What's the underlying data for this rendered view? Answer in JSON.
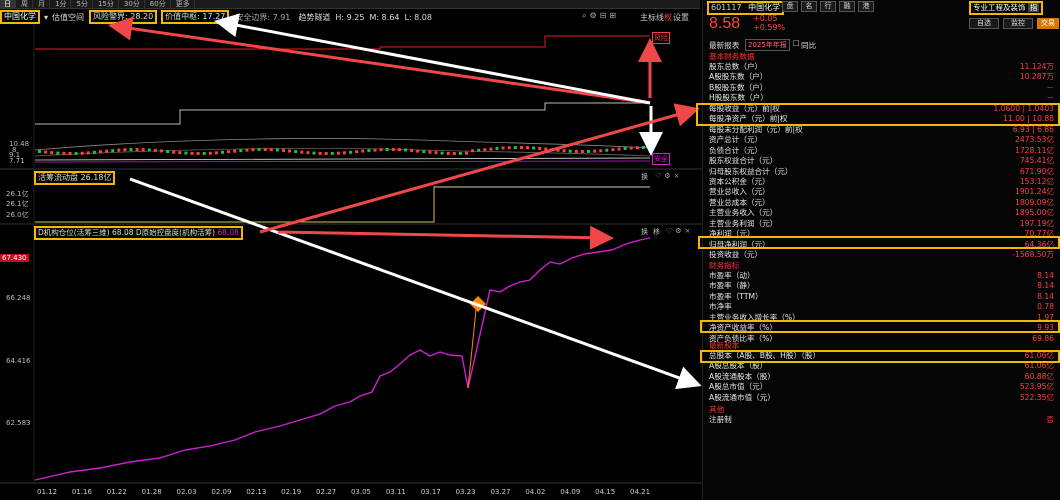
{
  "tabs": [
    "日",
    "周",
    "月",
    "1分",
    "5分",
    "15分",
    "30分",
    "60分",
    "更多"
  ],
  "title": {
    "stock_name": "中国化学",
    "label_space": "估值空间",
    "risk_label": "风险警界",
    "risk_value": "28.20",
    "center_label": "价值中枢",
    "center_value": "17.27",
    "safe_label": "安全边界",
    "safe_value": "7.91",
    "trend_label": "趋势隧道",
    "h_label": "H",
    "h_value": "9.25",
    "m_label": "M",
    "m_value": "8.64",
    "l_label": "L",
    "l_value": "8.08",
    "mode_label": "主标线",
    "ctrl_label": "权",
    "settings_label": "设置"
  },
  "main_chart": {
    "y_ticks": [
      "10.48",
      "8",
      "9.1",
      "7.71"
    ],
    "tag_risk": "风险",
    "tag_safe": "安全"
  },
  "sub1": {
    "label": "活筹流动盘",
    "value": "26.18亿",
    "y_ticks": [
      "26.1亿",
      "26.1亿",
      "26.0亿"
    ],
    "icon_text": "换"
  },
  "sub2": {
    "label": "D机构仓位(活筹三维)",
    "value1": "68.08",
    "label2": "D原始控盘度(机构活筹)",
    "value2": "68.08",
    "icon_text1": "换",
    "icon_text2": "移",
    "y_ticks": [
      "67.430",
      "66.248",
      "64.416",
      "62.583"
    ]
  },
  "x_axis": [
    "01.12",
    "01.16",
    "01.22",
    "01.28",
    "02.03",
    "02.09",
    "02.13",
    "02.19",
    "02.27",
    "03.05",
    "03.11",
    "03.17",
    "03.23",
    "03.27",
    "04.02",
    "04.09",
    "04.15",
    "04.21"
  ],
  "right": {
    "code": "601117",
    "name": "中国化学",
    "tabs": [
      "盘",
      "名",
      "行",
      "融",
      "港"
    ],
    "price": "8.58",
    "chg": "+0.05",
    "pct": "+0.59%",
    "industry": "专业工程及装饰",
    "industry_tag": "指",
    "btn_add": "自选",
    "btn_monitor": "监控",
    "btn_trade": "交易",
    "report_label": "最新报表",
    "report_year": "2025年年报",
    "compare_label": "同比",
    "sections": {
      "basic": "基本财务数据",
      "ratio": "财务指标",
      "capital": "最新股本",
      "other": "其他"
    },
    "basic_rows": [
      {
        "l": "股东总数（户）",
        "v": "11.124万"
      },
      {
        "l": "A股股东数（户）",
        "v": "10.287万"
      },
      {
        "l": "B股股东数（户）",
        "v": "－"
      },
      {
        "l": "H股股东数（户）",
        "v": "－"
      },
      {
        "l": "每股收益（元）前|权",
        "v": "1.0600 | 1.0403"
      },
      {
        "l": "每股净资产（元）前|权",
        "v": "11.00 | 10.88"
      },
      {
        "l": "每股未分配利润（元）前|权",
        "v": "6.93 | 6.86"
      },
      {
        "l": "资产总计（元）",
        "v": "2473.53亿"
      },
      {
        "l": "负债合计（元）",
        "v": "1728.11亿"
      },
      {
        "l": "股东权益合计（元）",
        "v": "745.41亿"
      },
      {
        "l": "归母股东权益合计（元）",
        "v": "671.90亿"
      },
      {
        "l": "资本公积金（元）",
        "v": "153.12亿"
      },
      {
        "l": "营业总收入（元）",
        "v": "1901.24亿"
      },
      {
        "l": "营业总成本（元）",
        "v": "1809.09亿"
      },
      {
        "l": "主营业务收入（元）",
        "v": "1895.00亿"
      },
      {
        "l": "主营业务利润（元）",
        "v": "197.19亿"
      },
      {
        "l": "净利润（元）",
        "v": "70.77亿"
      },
      {
        "l": "归母净利润（元）",
        "v": "64.36亿"
      },
      {
        "l": "投资收益（元）",
        "v": "-1568.50万"
      }
    ],
    "ratio_rows": [
      {
        "l": "市盈率（动）",
        "v": "8.14"
      },
      {
        "l": "市盈率（静）",
        "v": "8.14"
      },
      {
        "l": "市盈率（TTM）",
        "v": "8.14"
      },
      {
        "l": "市净率",
        "v": "0.78"
      },
      {
        "l": "主营业务收入增长率（%）",
        "v": "1.97"
      },
      {
        "l": "净资产收益率（%）",
        "v": "9.93"
      },
      {
        "l": "资产负债比率（%）",
        "v": "69.86"
      }
    ],
    "capital_rows": [
      {
        "l": "总股本（A股、B股、H股）（股）",
        "v": "61.06亿"
      },
      {
        "l": "A股总股本（股）",
        "v": "61.06亿"
      },
      {
        "l": "A股流通股本（股）",
        "v": "60.88亿"
      },
      {
        "l": "A股总市值（元）",
        "v": "523.95亿"
      },
      {
        "l": "A股流通市值（元）",
        "v": "522.35亿"
      }
    ],
    "other_rows": [
      {
        "l": "注册制",
        "v": "否"
      }
    ]
  },
  "colors": {
    "accent": "#f5b800",
    "up": "#ff4040",
    "line_purple": "#d020d0",
    "arrow_red": "#f04848",
    "arrow_white": "#ffffff"
  }
}
